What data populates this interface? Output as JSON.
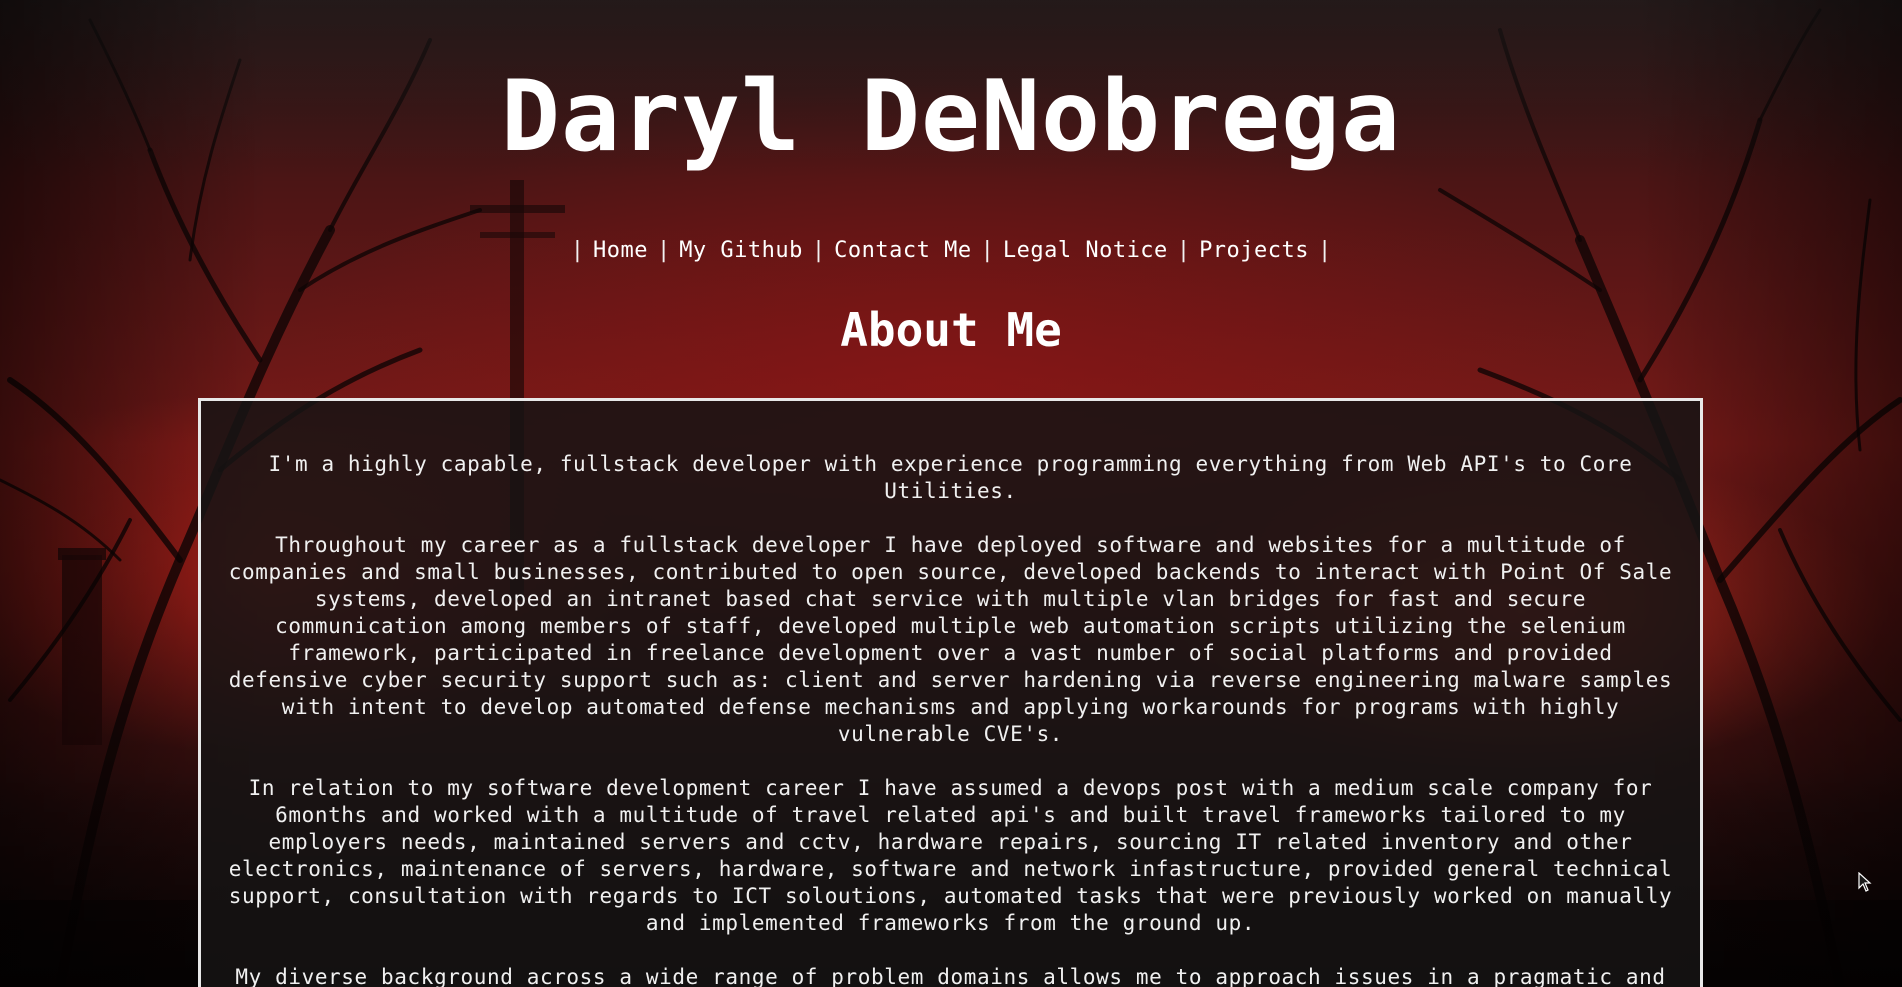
{
  "site": {
    "title": "Daryl DeNobrega"
  },
  "nav": {
    "separator": "|",
    "items": [
      {
        "label": "Home"
      },
      {
        "label": "My Github"
      },
      {
        "label": "Contact Me"
      },
      {
        "label": "Legal Notice"
      },
      {
        "label": "Projects"
      }
    ]
  },
  "about": {
    "heading": "About Me",
    "paragraphs": [
      "I'm a highly capable, fullstack developer with experience programming everything from Web API's to Core Utilities.",
      "Throughout my career as a fullstack developer I have deployed software and websites for a multitude of companies and small businesses, contributed to open source, developed backends to interact with Point Of Sale systems, developed an intranet based chat service with multiple vlan bridges for fast and secure communication among members of staff, developed multiple web automation scripts utilizing the selenium framework, participated in freelance development over a vast number of social platforms and provided defensive cyber security support such as: client and server hardening via reverse engineering malware samples with intent to develop automated defense mechanisms and applying workarounds for programs with highly vulnerable CVE's.",
      "In relation to my software development career I have assumed a devops post with a medium scale company for 6months and worked with a multitude of travel related api's and built travel frameworks tailored to my employers needs, maintained servers and cctv, hardware repairs, sourcing IT related inventory and other electronics, maintenance of servers, hardware, software and network infastructure, provided general technical support, consultation with regards to ICT soloutions, automated tasks that were previously worked on manually and implemented frameworks from the ground up.",
      "My diverse background across a wide range of problem domains allows me to approach issues in a pragmatic and all encompassing way."
    ]
  },
  "theme": {
    "text_color": "#ffffff",
    "box_border": "#e8e8e8",
    "box_background": "#161414",
    "background_accent": "#c2201a"
  }
}
